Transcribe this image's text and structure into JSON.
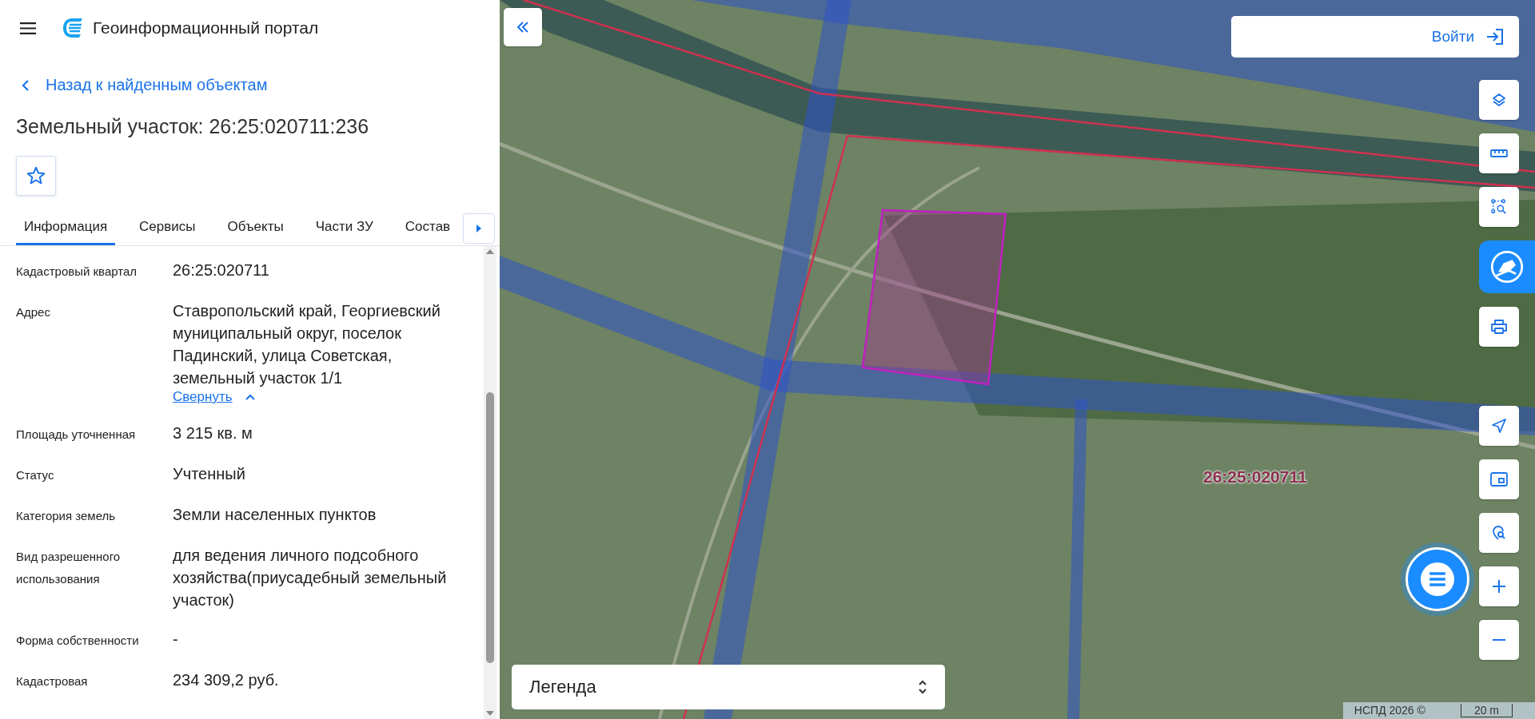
{
  "header": {
    "title": "Геоинформационный портал"
  },
  "back_link": "Назад к найденным объектам",
  "object_title": "Земельный участок: 26:25:020711:236",
  "tabs": [
    {
      "label": "Информация",
      "selected": true
    },
    {
      "label": "Сервисы",
      "selected": false
    },
    {
      "label": "Объекты",
      "selected": false
    },
    {
      "label": "Части ЗУ",
      "selected": false
    },
    {
      "label": "Состав",
      "selected": false
    }
  ],
  "properties": [
    {
      "label": "Кадастровый квартал",
      "value": "26:25:020711"
    },
    {
      "label": "Адрес",
      "value": "Ставропольский край, Георгиевский муниципальный округ, поселок Падинский, улица Советская, земельный участок 1/1",
      "collapse_link": "Свернуть"
    },
    {
      "label": "Площадь уточненная",
      "value": "3 215 кв. м"
    },
    {
      "label": "Статус",
      "value": "Учтенный"
    },
    {
      "label": "Категория земель",
      "value": "Земли населенных пунктов"
    },
    {
      "label": "Вид разрешенного использования",
      "value": "для ведения личного подсобного хозяйства(приусадебный земельный участок)"
    },
    {
      "label": "Форма собственности",
      "value": "-"
    },
    {
      "label": "Кадастровая",
      "value": "234 309,2 руб."
    }
  ],
  "map": {
    "login_button": "Войти",
    "quarter_label": "26:25:020711",
    "legend": "Легенда",
    "attribution": "НСПД 2026 ©",
    "scale": "20 m"
  }
}
